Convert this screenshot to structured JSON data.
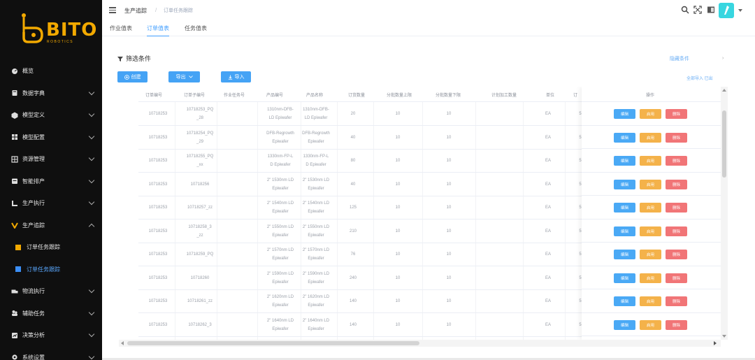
{
  "brand": {
    "name": "BITO",
    "sub": "ROBOTICS",
    "color": "#f2a900"
  },
  "sidebar": {
    "items": [
      {
        "label": "概览",
        "icon": "dashboard-icon",
        "chevron": "none"
      },
      {
        "label": "数据字典",
        "icon": "book-icon",
        "chevron": "down"
      },
      {
        "label": "模型定义",
        "icon": "cube-icon",
        "chevron": "down"
      },
      {
        "label": "模型配置",
        "icon": "settings-grid-icon",
        "chevron": "down"
      },
      {
        "label": "资源管理",
        "icon": "resource-icon",
        "chevron": "down"
      },
      {
        "label": "智能排产",
        "icon": "schedule-icon",
        "chevron": "down"
      },
      {
        "label": "生产执行",
        "icon": "execute-icon",
        "chevron": "down"
      },
      {
        "label": "生产追踪",
        "icon": "track-icon",
        "chevron": "up"
      },
      {
        "label": "订单任务跟踪",
        "icon": "square-orange-icon",
        "sub": true
      },
      {
        "label": "订单任务跟踪",
        "icon": "square-blue-icon",
        "sub": true,
        "active": true
      },
      {
        "label": "物流执行",
        "icon": "logistics-icon",
        "chevron": "down"
      },
      {
        "label": "辅助任务",
        "icon": "assist-icon",
        "chevron": "down"
      },
      {
        "label": "决策分析",
        "icon": "analysis-icon",
        "chevron": "down"
      },
      {
        "label": "系统设置",
        "icon": "gear-icon",
        "chevron": "down"
      }
    ]
  },
  "header": {
    "crumb1": "生产追踪",
    "separator": "/",
    "crumb2": "订单任务跟踪"
  },
  "tabs": [
    {
      "label": "作业值表"
    },
    {
      "label": "订单值表",
      "active": true
    },
    {
      "label": "任务值表"
    }
  ],
  "filter": {
    "title": "筛选条件",
    "collapse": "隐藏条件",
    "collapse_chev": "›"
  },
  "toolbar": {
    "create": "创建",
    "export": "导出",
    "import": "导入",
    "right_link": "全部导入 已出"
  },
  "table": {
    "columns": [
      "订单编号",
      "订单子编号",
      "作业任务号",
      "产品编号",
      "产品名称",
      "订货数量",
      "分批数量上限",
      "分批数量下限",
      "计划加工数量",
      "单位",
      "订"
    ],
    "action_header": "操作",
    "rows": [
      {
        "order": "10718253",
        "sub": [
          "10718253_PQ",
          "_28"
        ],
        "task": "",
        "code": [
          "1310nm-DFB-",
          "LD Epiwafer"
        ],
        "name": [
          "1310nm-DFB-",
          "LD Epiwafer"
        ],
        "qty": "20",
        "upper": "10",
        "lower": "10",
        "plan": "",
        "unit": "EA",
        "extra": "5"
      },
      {
        "order": "10718253",
        "sub": [
          "10718254_PQ",
          "_29"
        ],
        "task": "",
        "code": [
          "DFB-Regrowth",
          "Epiwafer"
        ],
        "name": [
          "DFB-Regrowth",
          "Epiwafer"
        ],
        "qty": "40",
        "upper": "10",
        "lower": "10",
        "plan": "",
        "unit": "EA",
        "extra": "5"
      },
      {
        "order": "10718253",
        "sub": [
          "10718255_PQ",
          "_xx"
        ],
        "task": "",
        "code": [
          "1330nm-FP-L",
          "D Epiwafer"
        ],
        "name": [
          "1330nm-FP-L",
          "D Epiwafer"
        ],
        "qty": "80",
        "upper": "10",
        "lower": "10",
        "plan": "",
        "unit": "EA",
        "extra": "5"
      },
      {
        "order": "10718253",
        "sub": [
          "10718256"
        ],
        "task": "",
        "code": [
          "2\" 1530nm LD",
          "Epiwafer"
        ],
        "name": [
          "2\" 1530nm LD",
          "Epiwafer"
        ],
        "qty": "40",
        "upper": "10",
        "lower": "10",
        "plan": "",
        "unit": "EA",
        "extra": "5"
      },
      {
        "order": "10718253",
        "sub": [
          "10718257_zz"
        ],
        "task": "",
        "code": [
          "2\" 1540nm LD",
          "Epiwafer"
        ],
        "name": [
          "2\" 1540nm LD",
          "Epiwafer"
        ],
        "qty": "125",
        "upper": "10",
        "lower": "10",
        "plan": "",
        "unit": "EA",
        "extra": "5"
      },
      {
        "order": "10718253",
        "sub": [
          "10718258_3",
          "_zz"
        ],
        "task": "",
        "code": [
          "2\" 1550nm LD",
          "Epiwafer"
        ],
        "name": [
          "2\" 1550nm LD",
          "Epiwafer"
        ],
        "qty": "210",
        "upper": "10",
        "lower": "10",
        "plan": "",
        "unit": "EA",
        "extra": "5"
      },
      {
        "order": "10718253",
        "sub": [
          "10718259_PQ"
        ],
        "task": "",
        "code": [
          "2\" 1570nm LD",
          "Epiwafer"
        ],
        "name": [
          "2\" 1570nm LD",
          "Epiwafer"
        ],
        "qty": "76",
        "upper": "10",
        "lower": "10",
        "plan": "",
        "unit": "EA",
        "extra": "5"
      },
      {
        "order": "10718253",
        "sub": [
          "10718260"
        ],
        "task": "",
        "code": [
          "2\" 1590nm LD",
          "Epiwafer"
        ],
        "name": [
          "2\" 1590nm LD",
          "Epiwafer"
        ],
        "qty": "240",
        "upper": "10",
        "lower": "10",
        "plan": "",
        "unit": "EA",
        "extra": "5"
      },
      {
        "order": "10718253",
        "sub": [
          "10718261_zz"
        ],
        "task": "",
        "code": [
          "2\" 1620nm LD",
          "Epiwafer"
        ],
        "name": [
          "2\" 1620nm LD",
          "Epiwafer"
        ],
        "qty": "140",
        "upper": "10",
        "lower": "10",
        "plan": "",
        "unit": "EA",
        "extra": "5"
      },
      {
        "order": "10718253",
        "sub": [
          "10718262_3"
        ],
        "task": "",
        "code": [
          "2\" 1640nm LD",
          "Epiwafer"
        ],
        "name": [
          "2\" 1640nm LD",
          "Epiwafer"
        ],
        "qty": "140",
        "upper": "10",
        "lower": "10",
        "plan": "",
        "unit": "EA",
        "extra": "5"
      }
    ],
    "actions": {
      "edit": "编辑",
      "start": "启用",
      "delete": "删除"
    }
  },
  "colors": {
    "accent": "#409eff",
    "button": "#45a3f5",
    "edit": "#4aa9f5",
    "start": "#f4b24a",
    "delete": "#f17577",
    "sidebar_bg": "#0f0f0f"
  }
}
